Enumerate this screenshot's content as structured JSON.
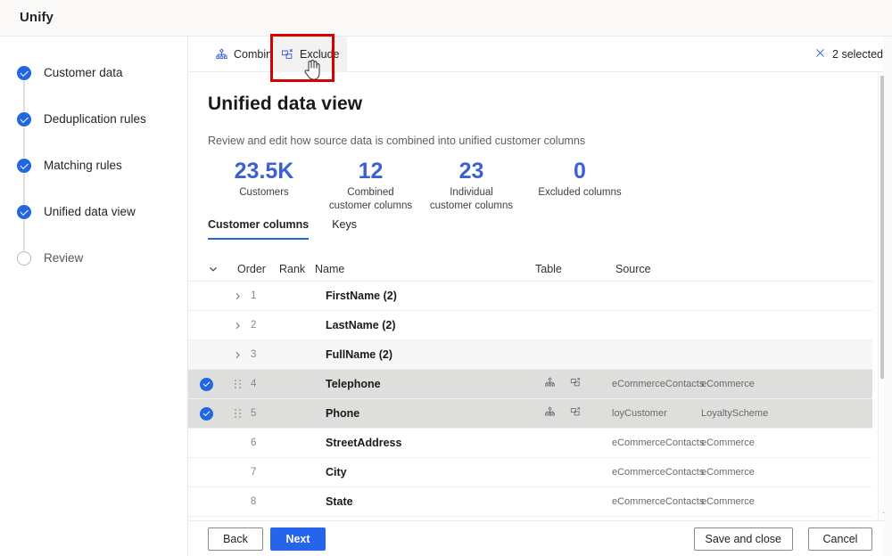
{
  "app": {
    "title": "Unify"
  },
  "sidebar": {
    "items": [
      {
        "label": "Customer data",
        "state": "done"
      },
      {
        "label": "Deduplication rules",
        "state": "done"
      },
      {
        "label": "Matching rules",
        "state": "done"
      },
      {
        "label": "Unified data view",
        "state": "done"
      },
      {
        "label": "Review",
        "state": "todo"
      }
    ]
  },
  "commandbar": {
    "combine_label": "Combine",
    "exclude_label": "Exclude",
    "selection_label": "2 selected",
    "clear_icon": "close-icon",
    "combine_icon": "combine-icon",
    "exclude_icon": "exclude-icon"
  },
  "page": {
    "title": "Unified data view",
    "subtitle": "Review and edit how source data is combined into unified customer columns"
  },
  "stats": [
    {
      "value": "23.5K",
      "label": "Customers"
    },
    {
      "value": "12",
      "label": "Combined customer columns"
    },
    {
      "value": "23",
      "label": "Individual customer columns"
    },
    {
      "value": "0",
      "label": "Excluded columns"
    }
  ],
  "tabs": [
    {
      "label": "Customer columns",
      "active": true
    },
    {
      "label": "Keys",
      "active": false
    }
  ],
  "table": {
    "headers": {
      "expand": "chevron-down-icon",
      "order": "Order",
      "rank": "Rank",
      "name": "Name",
      "table": "Table",
      "source": "Source"
    },
    "rows": [
      {
        "selected": false,
        "hovered": false,
        "expandable": true,
        "order": "1",
        "rank": "",
        "name": "FirstName (2)",
        "table": "",
        "source": "",
        "actions": false
      },
      {
        "selected": false,
        "hovered": false,
        "expandable": true,
        "order": "2",
        "rank": "",
        "name": "LastName (2)",
        "table": "",
        "source": "",
        "actions": false
      },
      {
        "selected": false,
        "hovered": true,
        "expandable": true,
        "order": "3",
        "rank": "",
        "name": "FullName (2)",
        "table": "",
        "source": "",
        "actions": false
      },
      {
        "selected": true,
        "hovered": false,
        "expandable": false,
        "order": "4",
        "rank": "",
        "name": "Telephone",
        "table": "eCommerceContacts",
        "source": "eCommerce",
        "actions": true
      },
      {
        "selected": true,
        "hovered": false,
        "expandable": false,
        "order": "5",
        "rank": "",
        "name": "Phone",
        "table": "loyCustomer",
        "source": "LoyaltyScheme",
        "actions": true
      },
      {
        "selected": false,
        "hovered": false,
        "expandable": false,
        "order": "6",
        "rank": "",
        "name": "StreetAddress",
        "table": "eCommerceContacts",
        "source": "eCommerce",
        "actions": false
      },
      {
        "selected": false,
        "hovered": false,
        "expandable": false,
        "order": "7",
        "rank": "",
        "name": "City",
        "table": "eCommerceContacts",
        "source": "eCommerce",
        "actions": false
      },
      {
        "selected": false,
        "hovered": false,
        "expandable": false,
        "order": "8",
        "rank": "",
        "name": "State",
        "table": "eCommerceContacts",
        "source": "eCommerce",
        "actions": false
      }
    ]
  },
  "footer": {
    "back": "Back",
    "next": "Next",
    "save": "Save and close",
    "cancel": "Cancel"
  },
  "colors": {
    "accent": "#2266e3",
    "primary_button": "#2664ec",
    "stat_value": "#3b5fd4",
    "annotation": "#d50000",
    "selected_row": "#dededd"
  }
}
